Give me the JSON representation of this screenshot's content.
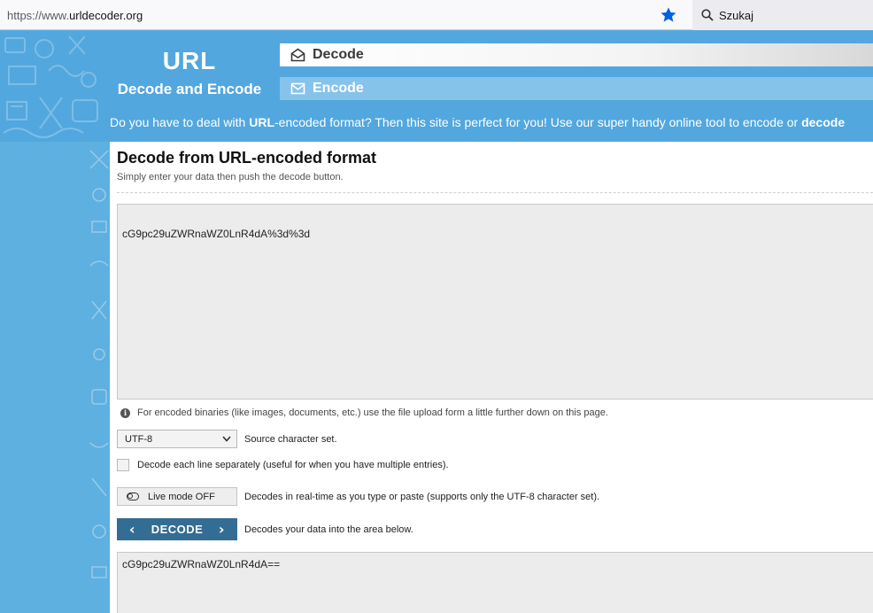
{
  "browser": {
    "url_prefix": "https://www.",
    "url_host": "urldecoder.org",
    "search_placeholder": "Szukaj"
  },
  "logo": {
    "title": "URL",
    "subtitle": "Decode and Encode"
  },
  "tabs": [
    {
      "label": "Decode",
      "icon": "envelope-open-icon",
      "active": true
    },
    {
      "label": "Encode",
      "icon": "envelope-icon",
      "active": false
    }
  ],
  "tagline": {
    "part1": "Do you have to deal with ",
    "bold1": "URL",
    "part2": "-encoded format? Then this site is perfect for you! Use our super handy online tool to encode or ",
    "bold2": "decode"
  },
  "main": {
    "title": "Decode from URL-encoded format",
    "subtitle": "Simply enter your data then push the decode button.",
    "input_value": "cG9pc29uZWRnaWZ0LnR4dA%3d%3d",
    "note": "For encoded binaries (like images, documents, etc.) use the file upload form a little further down on this page.",
    "charset_selected": "UTF-8",
    "charset_label": "Source character set.",
    "line_checkbox_label": "Decode each line separately (useful for when you have multiple entries).",
    "live_button_label": "Live mode OFF",
    "live_label": "Decodes in real-time as you type or paste (supports only the UTF-8 character set).",
    "decode_button_label": "DECODE",
    "decode_label": "Decodes your data into the area below.",
    "output_value": "cG9pc29uZWRnaWZ0LnR4dA=="
  },
  "colors": {
    "accent": "#346d93",
    "header_blue": "#52a7de",
    "bookmark_star": "#0061e0"
  }
}
